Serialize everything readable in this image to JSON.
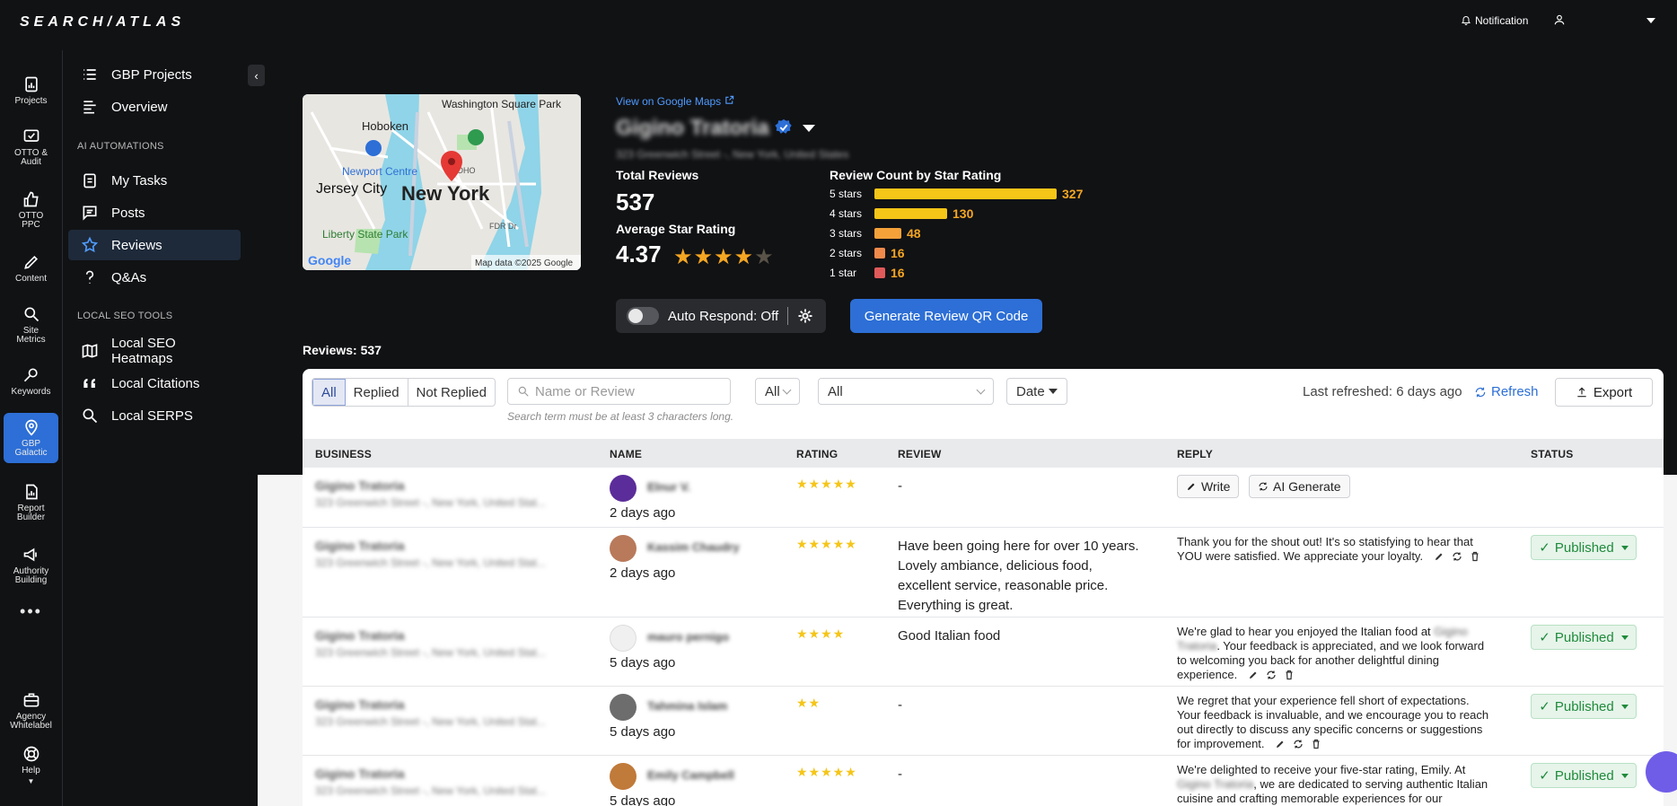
{
  "brand": {
    "logo": "SEARCH/ATLAS"
  },
  "topbar": {
    "notification": "Notification"
  },
  "rail": [
    {
      "label": "Projects",
      "icon": "projects-icon"
    },
    {
      "label": "OTTO & Audit",
      "icon": "audit-icon"
    },
    {
      "label": "OTTO PPC",
      "icon": "thumbs-up-icon"
    },
    {
      "label": "Content",
      "icon": "pen-icon"
    },
    {
      "label": "Site Metrics",
      "icon": "magnify-icon"
    },
    {
      "label": "Keywords",
      "icon": "keyword-icon"
    },
    {
      "label": "GBP Galactic",
      "icon": "map-pin-icon"
    },
    {
      "label": "Report Builder",
      "icon": "report-icon"
    },
    {
      "label": "Authority Building",
      "icon": "megaphone-icon"
    },
    {
      "label": "Agency Whitelabel",
      "icon": "briefcase-icon"
    },
    {
      "label": "Help",
      "icon": "lifebuoy-icon"
    }
  ],
  "sidebar": {
    "items_top": [
      {
        "label": "GBP Projects"
      },
      {
        "label": "Overview"
      }
    ],
    "section_ai": "AI AUTOMATIONS",
    "items_ai": [
      {
        "label": "My Tasks"
      },
      {
        "label": "Posts"
      },
      {
        "label": "Reviews"
      },
      {
        "label": "Q&As"
      }
    ],
    "section_local": "LOCAL SEO TOOLS",
    "items_local": [
      {
        "label": "Local SEO Heatmaps"
      },
      {
        "label": "Local Citations"
      },
      {
        "label": "Local SERPS"
      }
    ]
  },
  "map": {
    "labels": [
      "Hoboken",
      "Washington Square Park",
      "Newport Centre",
      "Jersey City",
      "New York",
      "SOHO",
      "Liberty State Park",
      "FDR Dr"
    ],
    "google": "Google",
    "attribution": "Map data ©2025 Google"
  },
  "business": {
    "gmaps_link": "View on Google Maps",
    "name": "Gigino Tratoria",
    "address": "323 Greenwich Street -, New York, United States"
  },
  "summary": {
    "total_label": "Total Reviews",
    "total": "537",
    "avg_label": "Average Star Rating",
    "avg": "4.37",
    "avg_value": 4.37,
    "stars_text": "★★★★",
    "stars_dim": "★",
    "dist_label": "Review Count by Star Rating",
    "distribution": [
      {
        "label": "5 stars",
        "count": "327",
        "value": 327,
        "color": "#f5c518"
      },
      {
        "label": "4 stars",
        "count": "130",
        "value": 130,
        "color": "#f5c518"
      },
      {
        "label": "3 stars",
        "count": "48",
        "value": 48,
        "color": "#f5a13a"
      },
      {
        "label": "2 stars",
        "count": "16",
        "value": 16,
        "color": "#f08a4b"
      },
      {
        "label": "1 star",
        "count": "16",
        "value": 16,
        "color": "#e05a5a"
      }
    ]
  },
  "actions": {
    "auto_respond": "Auto Respond: Off",
    "qr_button": "Generate Review QR Code"
  },
  "reviews_count": "Reviews: 537",
  "filters": {
    "tabs": [
      "All",
      "Replied",
      "Not Replied"
    ],
    "search_placeholder": "Name or Review",
    "search_hint": "Search term must be at least 3 characters long.",
    "rating_select": "All",
    "status_select": "All",
    "date_select": "Date",
    "last_refreshed": "Last refreshed: 6 days ago",
    "refresh": "Refresh",
    "export": "Export"
  },
  "table": {
    "headers": [
      "BUSINESS",
      "NAME",
      "RATING",
      "REVIEW",
      "REPLY",
      "STATUS"
    ],
    "rows": [
      {
        "business": "Gigino Tratoria",
        "address": "323 Greenwich Street -, New York, United Stat...",
        "name": "Elnur V.",
        "date": "2 days ago",
        "stars": "★★★★★",
        "review": "-",
        "reply": "",
        "write": "Write",
        "ai_generate": "AI Generate",
        "status": ""
      },
      {
        "business": "Gigino Tratoria",
        "address": "323 Greenwich Street -, New York, United Stat...",
        "name": "Kassim Chaudry",
        "date": "2 days ago",
        "stars": "★★★★★",
        "review": "Have been going here for over 10 years. Lovely ambiance, delicious food, excellent service, reasonable price. Everything is great.",
        "reply": "Thank you for the shout out! It's so statisfying to hear that YOU were satisfied. We appreciate your loyalty.",
        "status": "Published"
      },
      {
        "business": "Gigino Tratoria",
        "address": "323 Greenwich Street -, New York, United Stat...",
        "name": "mauro pernigo",
        "date": "5 days ago",
        "stars": "★★★★",
        "review": "Good Italian food",
        "reply_a": "We're glad to hear you enjoyed the Italian food at",
        "reply_blur": "Gigino Tratoria",
        "reply_b": ". Your feedback is appreciated, and we look forward to welcoming you back for another delightful dining experience.",
        "status": "Published"
      },
      {
        "business": "Gigino Tratoria",
        "address": "323 Greenwich Street -, New York, United Stat...",
        "name": "Tahmina Islam",
        "date": "5 days ago",
        "stars": "★★",
        "review": "-",
        "reply": "We regret that your experience fell short of expectations. Your feedback is invaluable, and we encourage you to reach out directly to discuss any specific concerns or suggestions for improvement.",
        "status": "Published"
      },
      {
        "business": "Gigino Tratoria",
        "address": "323 Greenwich Street -, New York, United Stat...",
        "name": "Emily Campbell",
        "date": "5 days ago",
        "stars": "★★★★★",
        "review": "-",
        "reply_a": "We're delighted to receive your five-star rating, Emily. At",
        "reply_blur": "Gigino Tratoria",
        "reply_b": ", we are dedicated to serving authentic Italian cuisine and crafting memorable experiences for our",
        "status": "Published"
      }
    ]
  },
  "colors": {
    "accent": "#2d6fd6",
    "star": "#f5a623",
    "published": "#1f8a3b"
  }
}
